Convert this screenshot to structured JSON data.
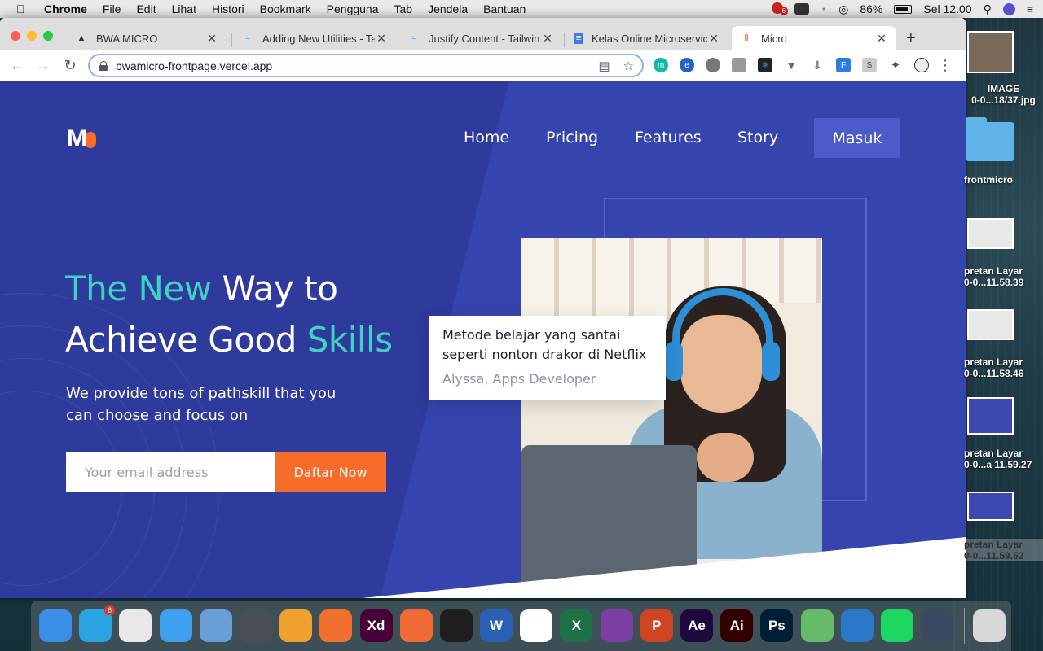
{
  "menubar": {
    "app_name": "Chrome",
    "items": [
      "File",
      "Edit",
      "Lihat",
      "Histori",
      "Bookmark",
      "Pengguna",
      "Tab",
      "Jendela",
      "Bantuan"
    ],
    "notification_count": "6",
    "battery": "86%",
    "clock": "Sel 12.00"
  },
  "browser": {
    "tabs": [
      {
        "title": "BWA MICRO"
      },
      {
        "title": "Adding New Utilities - Ta"
      },
      {
        "title": "Justify Content - Tailwin"
      },
      {
        "title": "Kelas Online Microservic"
      },
      {
        "title": "Micro"
      }
    ],
    "url": "bwamicro-frontpage.vercel.app"
  },
  "site": {
    "nav": {
      "home": "Home",
      "pricing": "Pricing",
      "features": "Features",
      "story": "Story",
      "login": "Masuk"
    },
    "hero": {
      "line1_teal": "The New",
      "line1_white": "Way to",
      "line2_white": "Achieve Good",
      "line2_teal": "Skills",
      "subtitle": "We provide tons of pathskill that you can choose and focus on",
      "email_placeholder": "Your email address",
      "cta": "Daftar Now"
    },
    "testimonial": {
      "text": "Metode belajar yang santai seperti nonton drakor di Netflix",
      "author": "Alyssa, Apps Developer"
    }
  },
  "desktop": {
    "items": [
      {
        "label_line1": "IMAGE",
        "label_line2": "0-0...18/37.jpg"
      },
      {
        "label_line1": "frontmicro",
        "label_line2": ""
      },
      {
        "label_line1": "pretan Layar",
        "label_line2": "0-0...11.58.39"
      },
      {
        "label_line1": "pretan Layar",
        "label_line2": "0-0...11.58.46"
      },
      {
        "label_line1": "pretan Layar",
        "label_line2": "0-0...a 11.59.27"
      },
      {
        "label_line1": "pretan Layar",
        "label_line2": "0-0...11.59.52"
      }
    ]
  },
  "dock": {
    "telegram_badge": "6",
    "apps": [
      {
        "name": "finder-icon",
        "label": "",
        "color": "#3a8ee6"
      },
      {
        "name": "telegram-icon",
        "label": "",
        "color": "#2aa3e0"
      },
      {
        "name": "chrome-icon",
        "label": "",
        "color": "#e8e8e8"
      },
      {
        "name": "safari-icon",
        "label": "",
        "color": "#3fa0f0"
      },
      {
        "name": "preview-icon",
        "label": "",
        "color": "#6a9ed6"
      },
      {
        "name": "tableplus-icon",
        "label": "",
        "color": "#4a4f55"
      },
      {
        "name": "postico-icon",
        "label": "",
        "color": "#f0a030"
      },
      {
        "name": "sourcetree-icon",
        "label": "",
        "color": "#f07030"
      },
      {
        "name": "adobe-xd-icon",
        "label": "Xd",
        "color": "#470137"
      },
      {
        "name": "postman-icon",
        "label": "",
        "color": "#f06a35"
      },
      {
        "name": "figma-icon",
        "label": "",
        "color": "#1e1e1e"
      },
      {
        "name": "word-icon",
        "label": "W",
        "color": "#2b5fb4"
      },
      {
        "name": "mongodb-icon",
        "label": "",
        "color": "#ffffff"
      },
      {
        "name": "excel-icon",
        "label": "X",
        "color": "#1e7145"
      },
      {
        "name": "github-desktop-icon",
        "label": "",
        "color": "#7a3fa0"
      },
      {
        "name": "powerpoint-icon",
        "label": "P",
        "color": "#d04423"
      },
      {
        "name": "after-effects-icon",
        "label": "Ae",
        "color": "#1f0740"
      },
      {
        "name": "illustrator-icon",
        "label": "Ai",
        "color": "#330000"
      },
      {
        "name": "photoshop-icon",
        "label": "Ps",
        "color": "#001e36"
      },
      {
        "name": "atom-icon",
        "label": "",
        "color": "#66bb6a"
      },
      {
        "name": "vscode-icon",
        "label": "",
        "color": "#2a78c8"
      },
      {
        "name": "spotify-icon",
        "label": "",
        "color": "#1ed760"
      },
      {
        "name": "quicktime-icon",
        "label": "",
        "color": "#3a4a60"
      },
      {
        "name": "trash-icon",
        "label": "",
        "color": "#d8d8d8"
      }
    ]
  },
  "colors": {
    "page_bg": "#2e3a9c",
    "accent_teal": "#3fd1c2",
    "accent_orange": "#f76c2a",
    "login_button": "#4d5ac9"
  }
}
